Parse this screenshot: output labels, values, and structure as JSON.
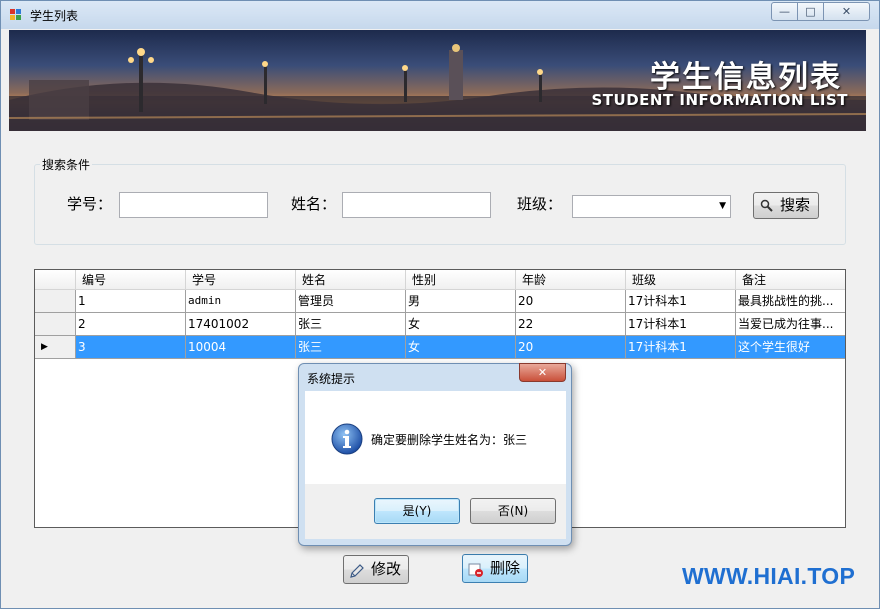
{
  "window": {
    "title": "学生列表",
    "controls": {
      "minimize": "—",
      "maximize": "□",
      "close": "✕"
    }
  },
  "banner": {
    "title": "学生信息列表",
    "subtitle": "STUDENT INFORMATION LIST"
  },
  "search": {
    "group_label": "搜索条件",
    "student_no_label": "学号：",
    "student_no_value": "",
    "name_label": "姓名：",
    "name_value": "",
    "class_label": "班级：",
    "class_value": "",
    "search_button": "搜索"
  },
  "table": {
    "columns": [
      "编号",
      "学号",
      "姓名",
      "性别",
      "年龄",
      "班级",
      "备注"
    ],
    "rows": [
      [
        "1",
        "admin",
        "管理员",
        "男",
        "20",
        "17计科本1",
        "最具挑战性的挑..."
      ],
      [
        "2",
        "17401002",
        "张三",
        "女",
        "22",
        "17计科本1",
        "当爱已成为往事..."
      ],
      [
        "3",
        "10004",
        "张三",
        "女",
        "20",
        "17计科本1",
        "这个学生很好"
      ]
    ],
    "selected_row": 3
  },
  "dialog": {
    "title": "系统提示",
    "message": "确定要删除学生姓名为：张三",
    "yes_button": "是(Y)",
    "no_button": "否(N)",
    "close": "✕"
  },
  "actions": {
    "edit_button": "修改",
    "delete_button": "删除"
  },
  "watermark": "WWW.HIAI.TOP",
  "colors": {
    "selection": "#3399ff",
    "watermark": "#1f6fd1"
  }
}
